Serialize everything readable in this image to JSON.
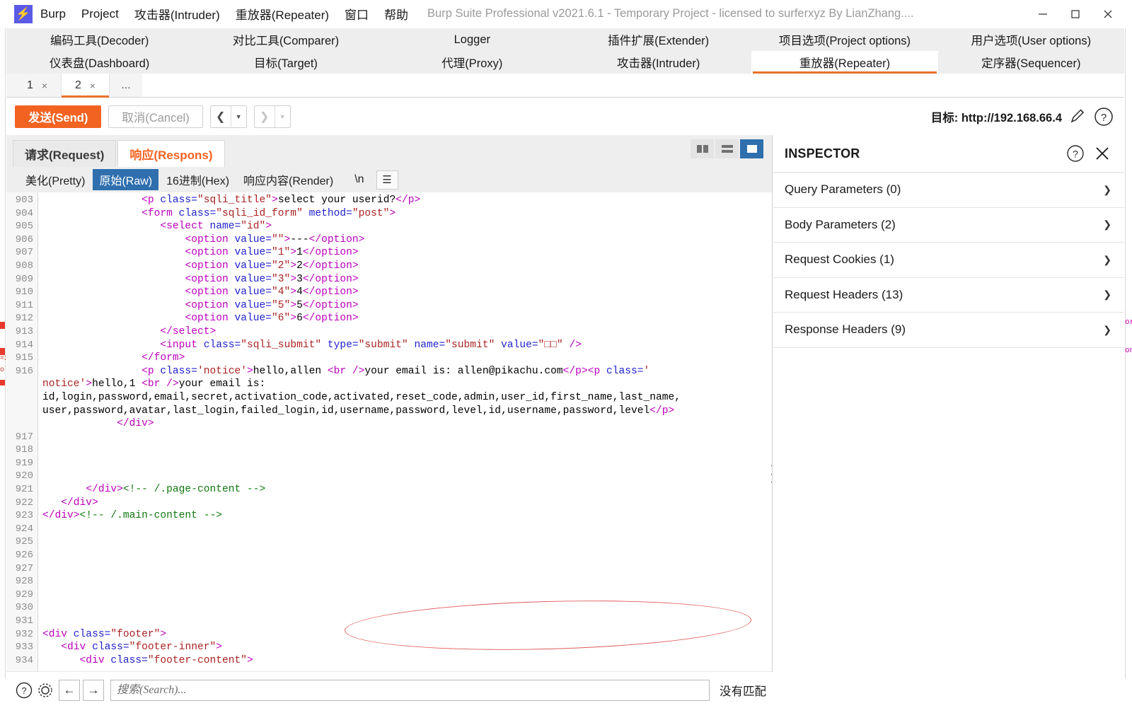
{
  "window": {
    "title": "Burp Suite Professional v2021.6.1 - Temporary Project - licensed to surferxyz By LianZhang....",
    "logo_icon": "burp-bolt-icon",
    "minimize_icon": "minimize-icon",
    "maximize_icon": "maximize-icon",
    "close_icon": "close-icon",
    "accent": "#f26322",
    "select_blue": "#2f6fae"
  },
  "menubar": {
    "items": [
      {
        "label": "Burp"
      },
      {
        "label": "Project"
      },
      {
        "label": "攻击器(Intruder)"
      },
      {
        "label": "重放器(Repeater)"
      },
      {
        "label": "窗口"
      },
      {
        "label": "帮助"
      }
    ]
  },
  "toptabs": {
    "row1": [
      {
        "label": "编码工具(Decoder)",
        "selected": false
      },
      {
        "label": "对比工具(Comparer)",
        "selected": false
      },
      {
        "label": "Logger",
        "selected": false
      },
      {
        "label": "插件扩展(Extender)",
        "selected": false
      },
      {
        "label": "项目选项(Project options)",
        "selected": false
      },
      {
        "label": "用户选项(User options)",
        "selected": false
      }
    ],
    "row2": [
      {
        "label": "仪表盘(Dashboard)",
        "selected": false
      },
      {
        "label": "目标(Target)",
        "selected": false
      },
      {
        "label": "代理(Proxy)",
        "selected": false
      },
      {
        "label": "攻击器(Intruder)",
        "selected": false
      },
      {
        "label": "重放器(Repeater)",
        "selected": true
      },
      {
        "label": "定序器(Sequencer)",
        "selected": false
      }
    ]
  },
  "repeater_tabs": {
    "tabs": [
      {
        "label": "1",
        "close": "×",
        "active": false
      },
      {
        "label": "2",
        "close": "×",
        "active": true
      }
    ],
    "more_label": "..."
  },
  "actionbar": {
    "send_label": "发送(Send)",
    "cancel_label": "取消(Cancel)",
    "back_icon": "chevron-left-icon",
    "forward_icon": "chevron-right-icon",
    "caret_icon": "caret-down-icon",
    "target_label": "目标: http://192.168.66.4",
    "edit_icon": "pencil-icon",
    "help_icon": "question-circle-icon"
  },
  "reqres": {
    "tabs": [
      {
        "label": "请求(Request)",
        "active": false
      },
      {
        "label": "响应(Respons)",
        "active": true
      }
    ],
    "layout_buttons": [
      {
        "name": "side-by-side-layout",
        "selected": false
      },
      {
        "name": "stacked-layout",
        "selected": false
      },
      {
        "name": "single-pane-layout",
        "selected": true
      }
    ],
    "viewmodes": [
      {
        "label": "美化(Pretty)",
        "selected": false
      },
      {
        "label": "原始(Raw)",
        "selected": true
      },
      {
        "label": "16进制(Hex)",
        "selected": false
      },
      {
        "label": "响应内容(Render)",
        "selected": false
      },
      {
        "label": "\\n",
        "selected": false
      }
    ],
    "menu_icon": "hamburger-icon"
  },
  "code": {
    "line_numbers": [
      "903",
      "904",
      "905",
      "906",
      "907",
      "908",
      "909",
      "910",
      "911",
      "912",
      "913",
      "914",
      "915",
      "916",
      "",
      "",
      "",
      "917",
      "918",
      "919",
      "920",
      "921",
      "922",
      "923",
      "924",
      "925",
      "926",
      "927",
      "928",
      "929",
      "930",
      "931",
      "932",
      "933",
      "934"
    ],
    "lines": [
      {
        "num": "903",
        "segments": [
          {
            "t": "txt",
            "s": "                "
          },
          {
            "t": "tag",
            "s": "<p "
          },
          {
            "t": "attr",
            "s": "class="
          },
          {
            "t": "val",
            "s": "\"sqli_title\""
          },
          {
            "t": "tag",
            "s": ">"
          },
          {
            "t": "txt",
            "s": "select your userid?"
          },
          {
            "t": "tag",
            "s": "</p>"
          }
        ]
      },
      {
        "num": "904",
        "segments": [
          {
            "t": "txt",
            "s": "                "
          },
          {
            "t": "tag",
            "s": "<form "
          },
          {
            "t": "attr",
            "s": "class="
          },
          {
            "t": "val",
            "s": "\"sqli_id_form\""
          },
          {
            "t": "attr",
            "s": " method="
          },
          {
            "t": "val",
            "s": "\"post\""
          },
          {
            "t": "tag",
            "s": ">"
          }
        ]
      },
      {
        "num": "905",
        "segments": [
          {
            "t": "txt",
            "s": "                   "
          },
          {
            "t": "tag",
            "s": "<select "
          },
          {
            "t": "attr",
            "s": "name="
          },
          {
            "t": "val",
            "s": "\"id\""
          },
          {
            "t": "tag",
            "s": ">"
          }
        ]
      },
      {
        "num": "906",
        "segments": [
          {
            "t": "txt",
            "s": "                       "
          },
          {
            "t": "tag",
            "s": "<option "
          },
          {
            "t": "attr",
            "s": "value="
          },
          {
            "t": "val",
            "s": "\"\""
          },
          {
            "t": "tag",
            "s": ">"
          },
          {
            "t": "txt",
            "s": "---"
          },
          {
            "t": "tag",
            "s": "</option>"
          }
        ]
      },
      {
        "num": "907",
        "segments": [
          {
            "t": "txt",
            "s": "                       "
          },
          {
            "t": "tag",
            "s": "<option "
          },
          {
            "t": "attr",
            "s": "value="
          },
          {
            "t": "val",
            "s": "\"1\""
          },
          {
            "t": "tag",
            "s": ">"
          },
          {
            "t": "txt",
            "s": "1"
          },
          {
            "t": "tag",
            "s": "</option>"
          }
        ]
      },
      {
        "num": "908",
        "segments": [
          {
            "t": "txt",
            "s": "                       "
          },
          {
            "t": "tag",
            "s": "<option "
          },
          {
            "t": "attr",
            "s": "value="
          },
          {
            "t": "val",
            "s": "\"2\""
          },
          {
            "t": "tag",
            "s": ">"
          },
          {
            "t": "txt",
            "s": "2"
          },
          {
            "t": "tag",
            "s": "</option>"
          }
        ]
      },
      {
        "num": "909",
        "segments": [
          {
            "t": "txt",
            "s": "                       "
          },
          {
            "t": "tag",
            "s": "<option "
          },
          {
            "t": "attr",
            "s": "value="
          },
          {
            "t": "val",
            "s": "\"3\""
          },
          {
            "t": "tag",
            "s": ">"
          },
          {
            "t": "txt",
            "s": "3"
          },
          {
            "t": "tag",
            "s": "</option>"
          }
        ]
      },
      {
        "num": "910",
        "segments": [
          {
            "t": "txt",
            "s": "                       "
          },
          {
            "t": "tag",
            "s": "<option "
          },
          {
            "t": "attr",
            "s": "value="
          },
          {
            "t": "val",
            "s": "\"4\""
          },
          {
            "t": "tag",
            "s": ">"
          },
          {
            "t": "txt",
            "s": "4"
          },
          {
            "t": "tag",
            "s": "</option>"
          }
        ]
      },
      {
        "num": "911",
        "segments": [
          {
            "t": "txt",
            "s": "                       "
          },
          {
            "t": "tag",
            "s": "<option "
          },
          {
            "t": "attr",
            "s": "value="
          },
          {
            "t": "val",
            "s": "\"5\""
          },
          {
            "t": "tag",
            "s": ">"
          },
          {
            "t": "txt",
            "s": "5"
          },
          {
            "t": "tag",
            "s": "</option>"
          }
        ]
      },
      {
        "num": "912",
        "segments": [
          {
            "t": "txt",
            "s": "                       "
          },
          {
            "t": "tag",
            "s": "<option "
          },
          {
            "t": "attr",
            "s": "value="
          },
          {
            "t": "val",
            "s": "\"6\""
          },
          {
            "t": "tag",
            "s": ">"
          },
          {
            "t": "txt",
            "s": "6"
          },
          {
            "t": "tag",
            "s": "</option>"
          }
        ]
      },
      {
        "num": "913",
        "segments": [
          {
            "t": "txt",
            "s": "                   "
          },
          {
            "t": "tag",
            "s": "</select>"
          }
        ]
      },
      {
        "num": "914",
        "segments": [
          {
            "t": "txt",
            "s": "                   "
          },
          {
            "t": "tag",
            "s": "<input "
          },
          {
            "t": "attr",
            "s": "class="
          },
          {
            "t": "val",
            "s": "\"sqli_submit\""
          },
          {
            "t": "attr",
            "s": " type="
          },
          {
            "t": "val",
            "s": "\"submit\""
          },
          {
            "t": "attr",
            "s": " name="
          },
          {
            "t": "val",
            "s": "\"submit\""
          },
          {
            "t": "attr",
            "s": " value="
          },
          {
            "t": "val",
            "s": "\"□□\""
          },
          {
            "t": "tag",
            "s": " />"
          }
        ]
      },
      {
        "num": "915",
        "segments": [
          {
            "t": "txt",
            "s": "                "
          },
          {
            "t": "tag",
            "s": "</form>"
          }
        ]
      },
      {
        "num": "916",
        "segments": [
          {
            "t": "txt",
            "s": "                "
          },
          {
            "t": "tag",
            "s": "<p "
          },
          {
            "t": "attr",
            "s": "class="
          },
          {
            "t": "val",
            "s": "'notice'"
          },
          {
            "t": "tag",
            "s": ">"
          },
          {
            "t": "txt",
            "s": "hello,allen "
          },
          {
            "t": "tag",
            "s": "<br />"
          },
          {
            "t": "txt",
            "s": "your email is: allen@pikachu.com"
          },
          {
            "t": "tag",
            "s": "</p>"
          },
          {
            "t": "tag",
            "s": "<p "
          },
          {
            "t": "attr",
            "s": "class="
          },
          {
            "t": "val",
            "s": "'"
          }
        ]
      },
      {
        "num": "",
        "segments": [
          {
            "t": "val",
            "s": "notice'"
          },
          {
            "t": "tag",
            "s": ">"
          },
          {
            "t": "txt",
            "s": "hello,1 "
          },
          {
            "t": "tag",
            "s": "<br />"
          },
          {
            "t": "txt",
            "s": "your email is:"
          }
        ]
      },
      {
        "num": "",
        "segments": [
          {
            "t": "txt",
            "s": "id,login,password,email,secret,activation_code,activated,reset_code,admin,user_id,first_name,last_name,"
          }
        ]
      },
      {
        "num": "",
        "segments": [
          {
            "t": "txt",
            "s": "user,password,avatar,last_login,failed_login,id,username,password,level,id,username,password,level"
          },
          {
            "t": "tag",
            "s": "</p>"
          }
        ]
      },
      {
        "num": "",
        "segments": [
          {
            "t": "txt",
            "s": "            "
          },
          {
            "t": "tag",
            "s": "</div>"
          }
        ]
      },
      {
        "num": "917",
        "segments": []
      },
      {
        "num": "918",
        "segments": []
      },
      {
        "num": "919",
        "segments": []
      },
      {
        "num": "920",
        "segments": []
      },
      {
        "num": "921",
        "segments": [
          {
            "t": "txt",
            "s": "       "
          },
          {
            "t": "tag",
            "s": "</div>"
          },
          {
            "t": "cmt",
            "s": "<!-- /.page-content -->"
          }
        ]
      },
      {
        "num": "922",
        "segments": [
          {
            "t": "txt",
            "s": "   "
          },
          {
            "t": "tag",
            "s": "</div>"
          }
        ]
      },
      {
        "num": "923",
        "segments": [
          {
            "t": "tag",
            "s": "</div>"
          },
          {
            "t": "cmt",
            "s": "<!-- /.main-content -->"
          }
        ]
      },
      {
        "num": "924",
        "segments": []
      },
      {
        "num": "925",
        "segments": []
      },
      {
        "num": "926",
        "segments": []
      },
      {
        "num": "927",
        "segments": []
      },
      {
        "num": "928",
        "segments": []
      },
      {
        "num": "929",
        "segments": []
      },
      {
        "num": "930",
        "segments": []
      },
      {
        "num": "931",
        "segments": []
      },
      {
        "num": "932",
        "segments": [
          {
            "t": "tag",
            "s": "<div "
          },
          {
            "t": "attr",
            "s": "class="
          },
          {
            "t": "val",
            "s": "\"footer\""
          },
          {
            "t": "tag",
            "s": ">"
          }
        ]
      },
      {
        "num": "933",
        "segments": [
          {
            "t": "txt",
            "s": "   "
          },
          {
            "t": "tag",
            "s": "<div "
          },
          {
            "t": "attr",
            "s": "class="
          },
          {
            "t": "val",
            "s": "\"footer-inner\""
          },
          {
            "t": "tag",
            "s": ">"
          }
        ]
      },
      {
        "num": "934",
        "segments": [
          {
            "t": "txt",
            "s": "      "
          },
          {
            "t": "tag",
            "s": "<div "
          },
          {
            "t": "attr",
            "s": "class="
          },
          {
            "t": "val",
            "s": "\"footer-content\""
          },
          {
            "t": "tag",
            "s": ">"
          }
        ]
      }
    ],
    "annotation": {
      "shape": "ellipse",
      "color": "#e05c5c"
    }
  },
  "inspector": {
    "title": "INSPECTOR",
    "help_icon": "question-circle-icon",
    "close_icon": "close-icon",
    "sections": [
      {
        "label": "Query Parameters (0)",
        "chevron": "chevron-down-icon"
      },
      {
        "label": "Body Parameters (2)",
        "chevron": "chevron-down-icon"
      },
      {
        "label": "Request Cookies (1)",
        "chevron": "chevron-down-icon"
      },
      {
        "label": "Request Headers (13)",
        "chevron": "chevron-down-icon"
      },
      {
        "label": "Response Headers (9)",
        "chevron": "chevron-down-icon"
      }
    ]
  },
  "searchbar": {
    "help_icon": "question-circle-icon",
    "settings_icon": "gear-icon",
    "prev_icon": "arrow-left-icon",
    "next_icon": "arrow-right-icon",
    "placeholder": "搜索(Search)...",
    "value": "",
    "status": "没有匹配"
  }
}
